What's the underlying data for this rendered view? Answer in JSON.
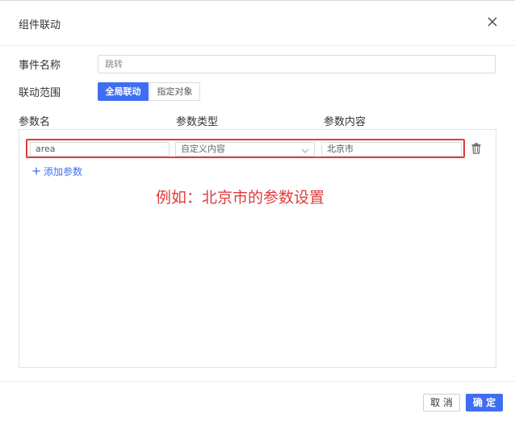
{
  "dialog": {
    "title": "组件联动"
  },
  "form": {
    "event_name_label": "事件名称",
    "event_name_value": "跳转",
    "scope_label": "联动范围",
    "scope_options": [
      "全局联动",
      "指定对象"
    ],
    "scope_selected": "全局联动"
  },
  "params": {
    "headers": [
      "参数名",
      "参数类型",
      "参数内容"
    ],
    "rows": [
      {
        "name": "area",
        "type": "自定义内容",
        "value": "北京市"
      }
    ],
    "add_label": "添加参数"
  },
  "annotation": {
    "text": "例如：北京市的参数设置",
    "color": "#e23a3a"
  },
  "footer": {
    "cancel_label": "取 消",
    "ok_label": "确 定"
  },
  "colors": {
    "primary": "#3f6ef3",
    "highlight": "#e23a3a"
  },
  "icons": {
    "close": "close-icon",
    "dropdown": "chevron-down-icon",
    "delete": "trash-icon",
    "add": "plus-icon"
  }
}
